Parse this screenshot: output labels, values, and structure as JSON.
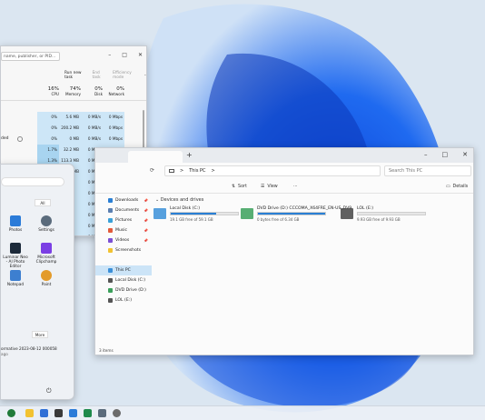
{
  "task_manager": {
    "search_placeholder": "name, publisher, or PID...",
    "window_controls": [
      "–",
      "□",
      "✕"
    ],
    "toolbar": {
      "run_new_task": "Run new task",
      "end_task": "End task",
      "efficiency_mode": "Efficiency mode",
      "more": "···"
    },
    "headers": [
      {
        "pct": "16%",
        "name": "CPU"
      },
      {
        "pct": "74%",
        "name": "Memory"
      },
      {
        "pct": "0%",
        "name": "Disk"
      },
      {
        "pct": "0%",
        "name": "Network"
      }
    ],
    "rows": [
      {
        "cpu": "0%",
        "mem": "5.6 MB",
        "disk": "0 MB/s",
        "net": "0 Mbps"
      },
      {
        "cpu": "0%",
        "mem": "200.2 MB",
        "disk": "0 MB/s",
        "net": "0 Mbps"
      },
      {
        "cpu": "0%",
        "mem": "0 MB",
        "disk": "0 MB/s",
        "net": "0 Mbps",
        "label": "ded"
      },
      {
        "cpu": "1.7%",
        "mem": "32.2 MB",
        "disk": "0 MB/s",
        "net": "0 Mbps"
      },
      {
        "cpu": "1.3%",
        "mem": "113.3 MB",
        "disk": "0 MB/s",
        "net": "0 Mbps"
      },
      {
        "cpu": "0%",
        "mem": "11.4 MB",
        "disk": "0 MB/s",
        "net": "0 Mbps"
      },
      {
        "cpu": "",
        "mem": "",
        "disk": "0 MB/s",
        "net": "0 Mbps"
      },
      {
        "cpu": "",
        "mem": "",
        "disk": "0 MB/s",
        "net": "0 Mbps"
      },
      {
        "cpu": "",
        "mem": "",
        "disk": "0 MB/s",
        "net": "0 Mbps"
      },
      {
        "cpu": "",
        "mem": "",
        "disk": "0 MB/s",
        "net": "0 Mbps"
      },
      {
        "cpu": "",
        "mem": "",
        "disk": "0 MB/s",
        "net": "0 Mbps"
      },
      {
        "cpu": "",
        "mem": "",
        "disk": "0 MB/s",
        "net": "0 Mbps"
      },
      {
        "cpu": "",
        "mem": "",
        "disk": "0 MB/s",
        "net": "0 Mbps"
      },
      {
        "cpu": "",
        "mem": "",
        "disk": "0 MB/s",
        "net": "0 Mbps"
      }
    ]
  },
  "start_menu": {
    "all_label": "All",
    "apps": [
      {
        "label": "Photos",
        "color": "#2b7bd8"
      },
      {
        "label": "Settings",
        "color": "#5a6b7c"
      },
      {
        "label": "Luminar Neo - AI Photo Editor",
        "color": "#1c2a3a"
      },
      {
        "label": "Microsoft Clipchamp",
        "color": "#7b3fe4"
      },
      {
        "label": "Notepad",
        "color": "#3d7fd0"
      },
      {
        "label": "Paint",
        "color": "#e39b2b"
      }
    ],
    "more_label": "More",
    "recommended_lines": [
      "ormative 2023-08-12 000058",
      "ago"
    ],
    "power_icon": "⏻"
  },
  "explorer": {
    "tab_add": "+",
    "window_controls": [
      "–",
      "□",
      "✕"
    ],
    "path_label": "This PC",
    "path_chevron": ">",
    "search_placeholder": "Search This PC",
    "cmd": {
      "sort": "Sort",
      "view": "View",
      "more": "···",
      "details": "Details"
    },
    "nav": [
      {
        "label": "Downloads",
        "pinned": true
      },
      {
        "label": "Documents",
        "pinned": true
      },
      {
        "label": "Pictures",
        "pinned": true
      },
      {
        "label": "Music",
        "pinned": true
      },
      {
        "label": "Videos",
        "pinned": true
      },
      {
        "label": "Screenshots",
        "pinned": false
      },
      {
        "label": "",
        "pinned": false
      },
      {
        "label": "This PC",
        "pinned": false,
        "selected": true
      },
      {
        "label": "Local Disk (C:)",
        "pinned": false
      },
      {
        "label": "DVD Drive (D:)",
        "pinned": false
      },
      {
        "label": "LOL (E:)",
        "pinned": false
      }
    ],
    "section_title": "Devices and drives",
    "drives": [
      {
        "name": "Local Disk (C:)",
        "free": "19.1 GB free of 59.1 GB",
        "used_fraction": 0.68
      },
      {
        "name": "DVD Drive (D:) CCCOMA_X64FRE_EN-US_DV9",
        "free": "0 bytes free of 6.34 GB",
        "used_fraction": 1.0
      },
      {
        "name": "LOL (E:)",
        "free": "9.93 GB free of 9.93 GB",
        "used_fraction": 0.0
      }
    ],
    "status": "3 items"
  },
  "colors": {
    "accent": "#2a7fd4",
    "wallpaper": "#1f5fd6"
  }
}
